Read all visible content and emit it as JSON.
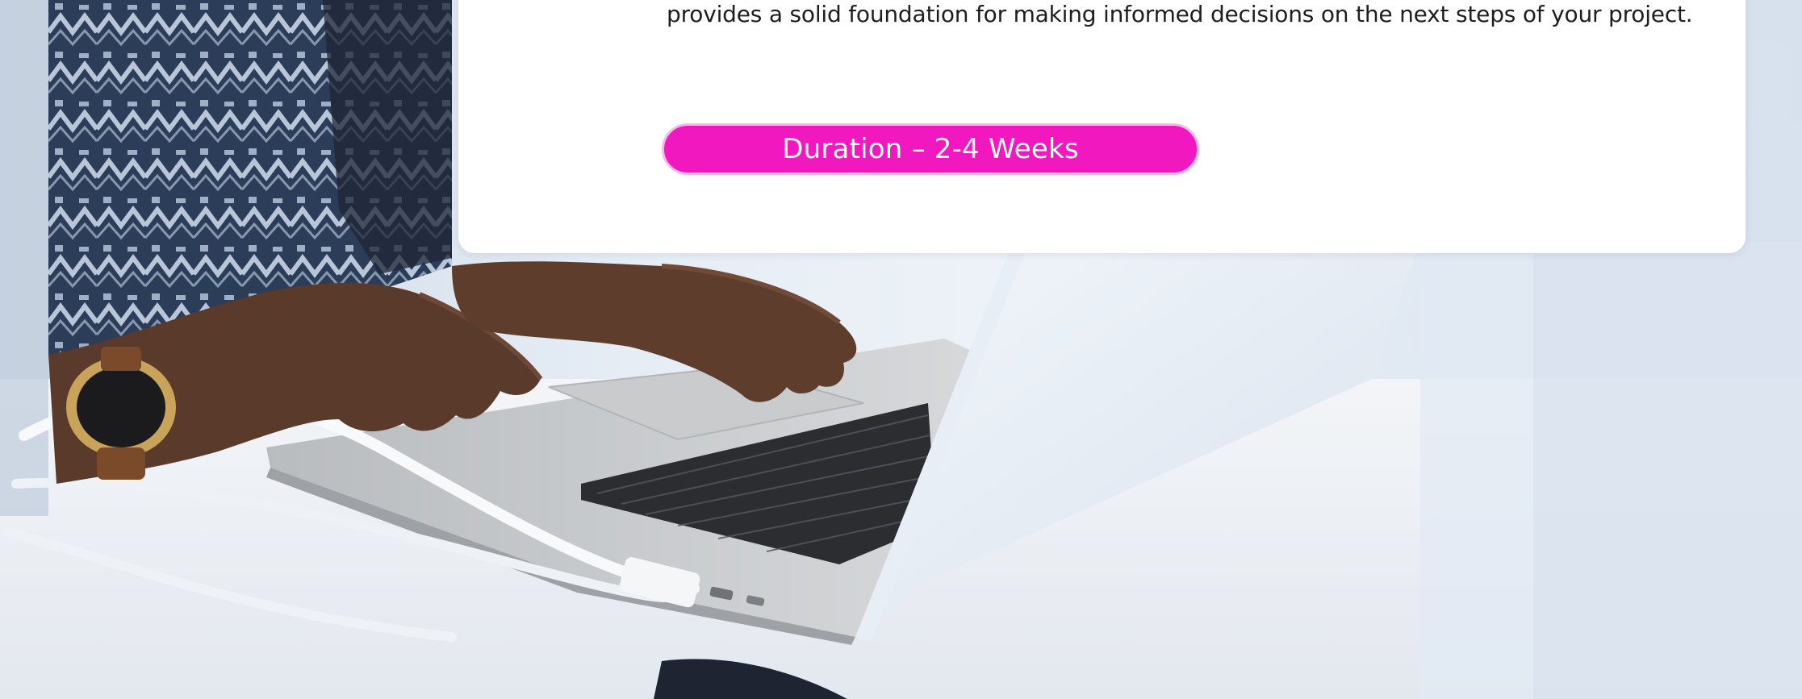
{
  "card": {
    "body_text": "provides a solid foundation for making informed decisions on the next steps of your project."
  },
  "duration_badge": {
    "label": "Duration – 2-4 Weeks"
  },
  "colors": {
    "accent": "#f118bf",
    "card_background": "#ffffff",
    "text": "#1e1e1e"
  }
}
